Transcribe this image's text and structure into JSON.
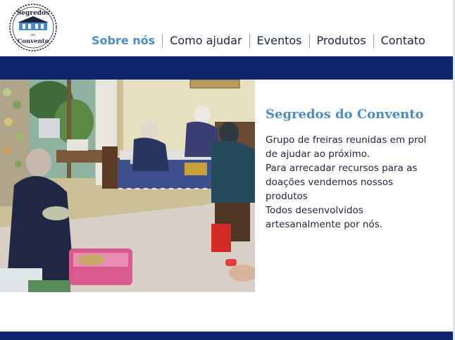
{
  "brand": {
    "logo_top": "Segredos",
    "logo_mid": "do",
    "logo_bottom": "Convento"
  },
  "nav": {
    "items": [
      {
        "label": "Sobre nós",
        "active": true
      },
      {
        "label": "Como ajudar",
        "active": false
      },
      {
        "label": "Eventos",
        "active": false
      },
      {
        "label": "Produtos",
        "active": false
      },
      {
        "label": "Contato",
        "active": false
      }
    ]
  },
  "colors": {
    "primary_dark": "#0d256f",
    "accent": "#4a8cc9",
    "text": "#1c2540"
  },
  "about": {
    "title": "Segredos do Convento",
    "lines": [
      "Grupo de freiras reunidas em prol",
      "de ajudar ao próximo.",
      "Para arrecadar recursos para as",
      "doações vendemos nossos",
      "produtos",
      "Todos desenvolvidos",
      "artesanalmente por nós."
    ]
  }
}
